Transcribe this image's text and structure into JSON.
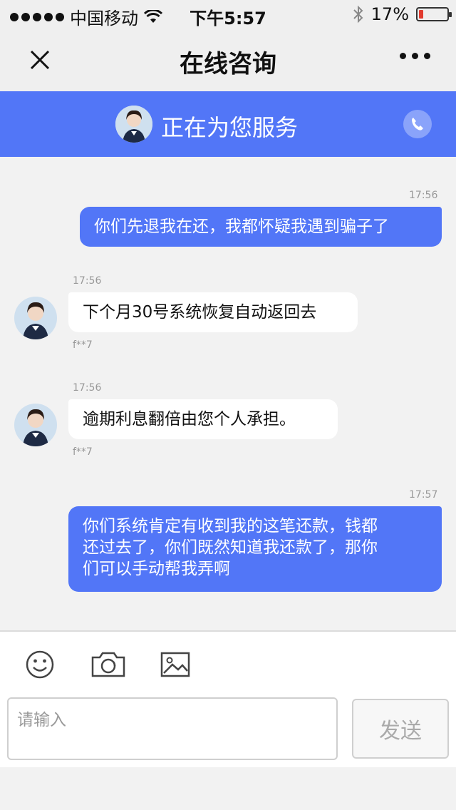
{
  "status_bar": {
    "carrier": "中国移动",
    "time": "下午5:57",
    "battery_text": "17%",
    "battery_level": 0.17,
    "battery_color": "#e23b2f",
    "icons": [
      "signal-dots-icon",
      "wifi-icon",
      "bluetooth-icon",
      "battery-icon"
    ]
  },
  "nav": {
    "title": "在线咨询",
    "close_icon": "close-icon",
    "more_icon": "more-icon"
  },
  "banner": {
    "status": "正在为您服务",
    "accent": "#5276f7",
    "phone_icon": "phone-icon"
  },
  "messages": [
    {
      "direction": "out",
      "time": "17:56",
      "text": "你们先退我在还，我都怀疑我遇到骗子了"
    },
    {
      "direction": "in",
      "time": "17:56",
      "text": "下个月30号系统恢复自动返回去",
      "sender": "f**7"
    },
    {
      "direction": "in",
      "time": "17:56",
      "text": "逾期利息翻倍由您个人承担。",
      "sender": "f**7"
    },
    {
      "direction": "out",
      "time": "17:57",
      "lines": [
        "你们系统肯定有收到我的这笔还款，钱都",
        "还过去了，你们既然知道我还款了，那你",
        "们可以手动帮我弄啊"
      ]
    }
  ],
  "composer": {
    "tools": [
      "emoji-icon",
      "camera-icon",
      "image-icon"
    ],
    "placeholder": "请输入",
    "send_label": "发送"
  }
}
